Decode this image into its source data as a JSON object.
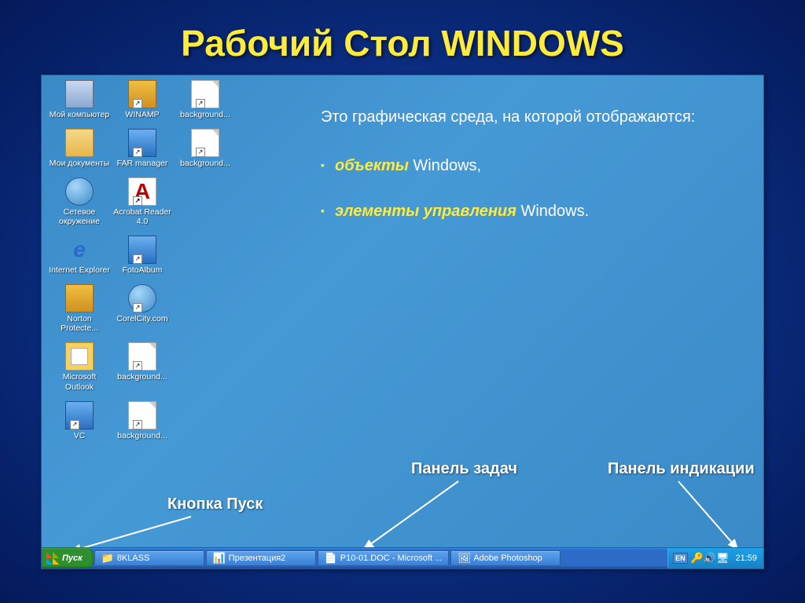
{
  "slide": {
    "title": "Рабочий Стол WINDOWS",
    "intro": "Это графическая среда, на которой отображаются:",
    "bullets": [
      {
        "em": "объекты",
        "rest": " Windows,"
      },
      {
        "em": "элементы управления",
        "rest": " Windows."
      }
    ],
    "annotations": {
      "start_button": "Кнопка Пуск",
      "taskbar": "Панель задач",
      "systray": "Панель индикации"
    }
  },
  "desktop": {
    "icons": [
      [
        {
          "id": "my-computer",
          "label": "Мой компьютер",
          "glyph": "computer"
        },
        {
          "id": "winamp",
          "label": "WINAMP",
          "glyph": "app",
          "shortcut": true
        },
        {
          "id": "background1",
          "label": "background...",
          "glyph": "page",
          "shortcut": true
        }
      ],
      [
        {
          "id": "my-documents",
          "label": "Мои документы",
          "glyph": "folder"
        },
        {
          "id": "far-manager",
          "label": "FAR manager",
          "glyph": "blue",
          "shortcut": true
        },
        {
          "id": "background2",
          "label": "background...",
          "glyph": "page",
          "shortcut": true
        }
      ],
      [
        {
          "id": "network",
          "label": "Сетевое окружение",
          "glyph": "globe"
        },
        {
          "id": "acrobat",
          "label": "Acrobat Reader 4.0",
          "glyph": "pdf",
          "shortcut": true
        }
      ],
      [
        {
          "id": "ie",
          "label": "Internet Explorer",
          "glyph": "ie"
        },
        {
          "id": "fotoalbum",
          "label": "FotoAlbum",
          "glyph": "blue",
          "shortcut": true
        }
      ],
      [
        {
          "id": "norton",
          "label": "Norton Protecte...",
          "glyph": "app"
        },
        {
          "id": "corelcity",
          "label": "CorelCity.com",
          "glyph": "globe",
          "shortcut": true
        }
      ],
      [
        {
          "id": "outlook",
          "label": "Microsoft Outlook",
          "glyph": "outlook"
        },
        {
          "id": "background3",
          "label": "background...",
          "glyph": "page",
          "shortcut": true
        }
      ],
      [
        {
          "id": "vc",
          "label": "VC",
          "glyph": "blue",
          "shortcut": true
        },
        {
          "id": "background4",
          "label": "background...",
          "glyph": "page",
          "shortcut": true
        }
      ]
    ]
  },
  "taskbar": {
    "start_label": "Пуск",
    "items": [
      {
        "id": "8klass",
        "label": "8KLASS",
        "icon": "📁"
      },
      {
        "id": "presentation2",
        "label": "Презентация2",
        "icon": "📊"
      },
      {
        "id": "p10doc",
        "label": "P10-01.DOC - Microsoft ...",
        "icon": "📄"
      },
      {
        "id": "photoshop",
        "label": "Adobe Photoshop",
        "icon": "🖼"
      }
    ],
    "systray": {
      "language": "EN",
      "icons": [
        "🔑",
        "🔊",
        "🖥"
      ],
      "clock": "21:59"
    }
  }
}
